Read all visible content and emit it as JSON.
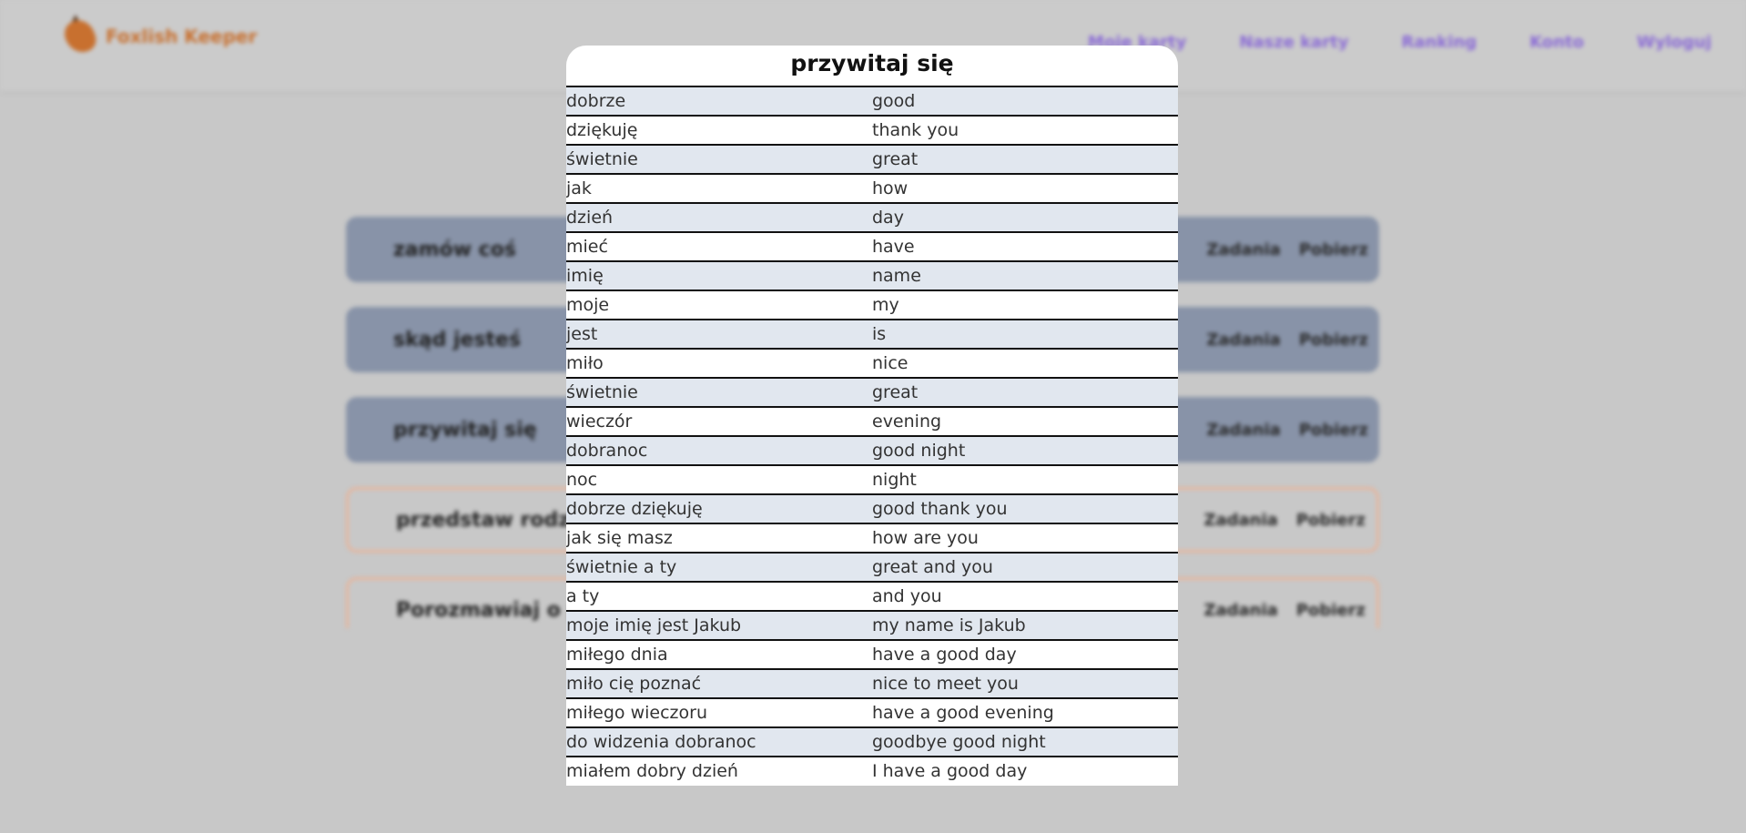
{
  "app": {
    "brand": "Foxlish Keeper",
    "colors": {
      "brand": "#c8702f",
      "nav_link": "#8a6ad6",
      "row_shade": "#e1e7ef"
    }
  },
  "nav": {
    "links": [
      "Moje karty",
      "Nasze karty",
      "Ranking",
      "Konto",
      "Wyloguj"
    ]
  },
  "decks": [
    {
      "title": "zamów coś",
      "style": "blue",
      "task_label": "Zadania",
      "download_label": "Pobierz"
    },
    {
      "title": "skąd jesteś",
      "style": "blue",
      "task_label": "Zadania",
      "download_label": "Pobierz"
    },
    {
      "title": "przywitaj się",
      "style": "blue",
      "task_label": "Zadania",
      "download_label": "Pobierz"
    },
    {
      "title": "przedstaw rodzinę",
      "style": "orange",
      "task_label": "Zadania",
      "download_label": "Pobierz"
    },
    {
      "title": "Porozmawiaj o pogodzie",
      "style": "orange",
      "task_label": "Zadania",
      "download_label": "Pobierz"
    }
  ],
  "modal": {
    "title": "przywitaj się",
    "words": [
      {
        "pl": "dobrze",
        "en": "good"
      },
      {
        "pl": "dziękuję",
        "en": "thank you"
      },
      {
        "pl": "świetnie",
        "en": "great"
      },
      {
        "pl": "jak",
        "en": "how"
      },
      {
        "pl": "dzień",
        "en": "day"
      },
      {
        "pl": "mieć",
        "en": "have"
      },
      {
        "pl": "imię",
        "en": "name"
      },
      {
        "pl": "moje",
        "en": "my"
      },
      {
        "pl": "jest",
        "en": "is"
      },
      {
        "pl": "miło",
        "en": "nice"
      },
      {
        "pl": "świetnie",
        "en": "great"
      },
      {
        "pl": "wieczór",
        "en": "evening"
      },
      {
        "pl": "dobranoc",
        "en": "good night"
      },
      {
        "pl": "noc",
        "en": "night"
      },
      {
        "pl": "dobrze dziękuję",
        "en": "good thank you"
      },
      {
        "pl": "jak się masz",
        "en": "how are you"
      },
      {
        "pl": "świetnie a ty",
        "en": "great and you"
      },
      {
        "pl": "a ty",
        "en": "and you"
      },
      {
        "pl": "moje imię jest Jakub",
        "en": "my name is Jakub"
      },
      {
        "pl": "miłego dnia",
        "en": "have a good day"
      },
      {
        "pl": "miło cię poznać",
        "en": "nice to meet you"
      },
      {
        "pl": "miłego wieczoru",
        "en": "have a good evening"
      },
      {
        "pl": "do widzenia dobranoc",
        "en": "goodbye good night"
      },
      {
        "pl": "miałem dobry dzień",
        "en": "I have a good day"
      }
    ]
  }
}
